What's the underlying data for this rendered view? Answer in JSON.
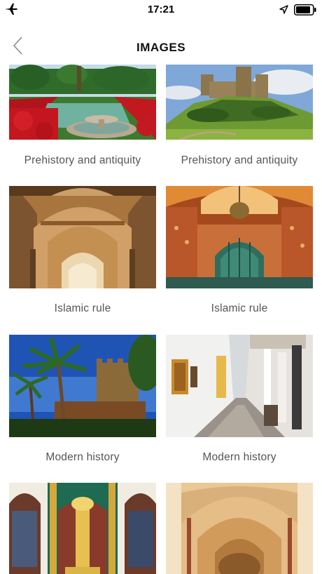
{
  "status_bar": {
    "time": "17:21",
    "left_icon": "airplane-icon",
    "right_icons": [
      "location-arrow-icon",
      "battery-icon"
    ]
  },
  "header": {
    "title": "IMAGES",
    "back_icon": "chevron-left-icon"
  },
  "gallery": {
    "items": [
      {
        "caption": "Prehistory and antiquity",
        "image": "alcazar garden fountain"
      },
      {
        "caption": "Prehistory and antiquity",
        "image": "castle on hill"
      },
      {
        "caption": "Islamic rule",
        "image": "mosque arches"
      },
      {
        "caption": "Islamic rule",
        "image": "ornate mihrab"
      },
      {
        "caption": "Modern history",
        "image": "palm trees and walls"
      },
      {
        "caption": "Modern history",
        "image": "narrow whitewashed street"
      },
      {
        "caption": "",
        "image": "golden altar"
      },
      {
        "caption": "",
        "image": "gothic vaulted nave"
      }
    ]
  },
  "colors": {
    "background": "#ffffff",
    "text": "#1c1c1c",
    "caption": "#555555"
  }
}
